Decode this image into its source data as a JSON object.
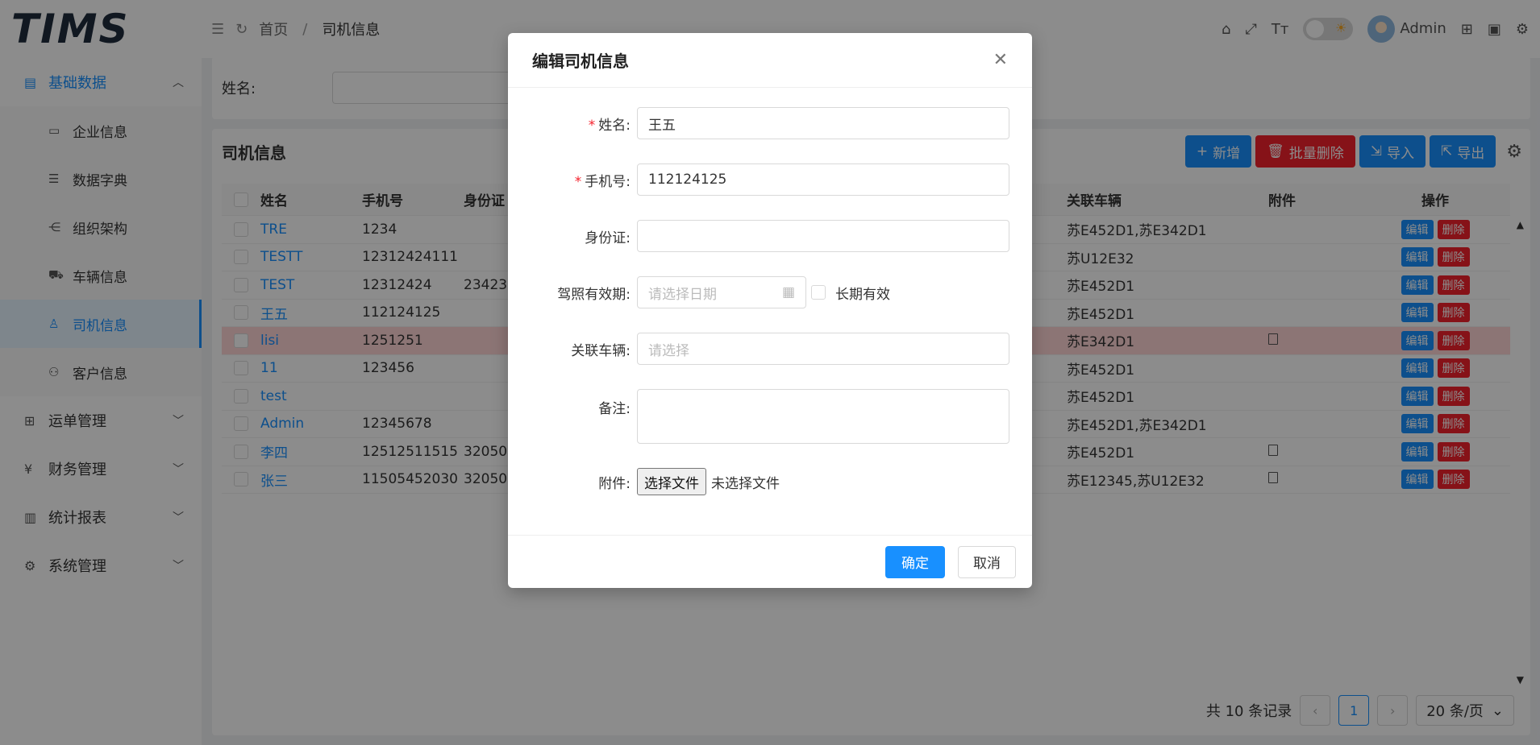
{
  "header": {
    "logo": "TIMS",
    "breadcrumb_home": "首页",
    "breadcrumb_sep": "/",
    "breadcrumb_current": "司机信息",
    "user_name": "Admin"
  },
  "sidebar": {
    "groups": [
      {
        "label": "基础数据",
        "icon": "list-icon"
      },
      {
        "label": "运单管理",
        "icon": "grid-icon"
      },
      {
        "label": "财务管理",
        "icon": "yen-icon"
      },
      {
        "label": "统计报表",
        "icon": "bar-chart-icon"
      },
      {
        "label": "系统管理",
        "icon": "gear-icon"
      }
    ],
    "sub_items": [
      {
        "label": "企业信息",
        "icon": "image-icon"
      },
      {
        "label": "数据字典",
        "icon": "list-icon"
      },
      {
        "label": "组织架构",
        "icon": "org-icon"
      },
      {
        "label": "车辆信息",
        "icon": "car-icon"
      },
      {
        "label": "司机信息",
        "icon": "user-icon"
      },
      {
        "label": "客户信息",
        "icon": "users-icon"
      }
    ]
  },
  "search": {
    "name_label": "姓名:"
  },
  "table": {
    "title": "司机信息",
    "buttons": {
      "add": "新增",
      "batch_delete": "批量删除",
      "import": "导入",
      "export": "导出"
    },
    "columns": {
      "name": "姓名",
      "phone": "手机号",
      "id": "身份证",
      "vehicle": "关联车辆",
      "attachment": "附件",
      "ops": "操作"
    },
    "op_edit": "编辑",
    "op_delete": "删除",
    "rows": [
      {
        "name": "TRE",
        "phone": "1234",
        "id": "",
        "vehicle": "苏E452D1,苏E342D1",
        "has_file": false
      },
      {
        "name": "TESTT",
        "phone": "12312424111",
        "id": "",
        "vehicle": "苏U12E32",
        "has_file": false
      },
      {
        "name": "TEST",
        "phone": "12312424",
        "id": "23423",
        "vehicle": "苏E452D1",
        "has_file": false
      },
      {
        "name": "王五",
        "phone": "112124125",
        "id": "",
        "vehicle": "苏E452D1",
        "has_file": false
      },
      {
        "name": "lisi",
        "phone": "1251251",
        "id": "",
        "vehicle": "苏E342D1",
        "has_file": true
      },
      {
        "name": "11",
        "phone": "123456",
        "id": "",
        "vehicle": "苏E452D1",
        "has_file": false
      },
      {
        "name": "test",
        "phone": "",
        "id": "",
        "vehicle": "苏E452D1",
        "has_file": false
      },
      {
        "name": "Admin",
        "phone": "12345678",
        "id": "",
        "vehicle": "苏E452D1,苏E342D1",
        "has_file": false
      },
      {
        "name": "李四",
        "phone": "12512511515",
        "id": "32050",
        "vehicle": "苏E452D1",
        "has_file": true
      },
      {
        "name": "张三",
        "phone": "11505452030",
        "id": "32050",
        "vehicle": "苏E12345,苏U12E32",
        "has_file": true
      }
    ]
  },
  "pager": {
    "total_text": "共 10 条记录",
    "current_page": "1",
    "page_size": "20 条/页"
  },
  "modal": {
    "title": "编辑司机信息",
    "fields": {
      "name_label": "姓名:",
      "name_value": "王五",
      "phone_label": "手机号:",
      "phone_value": "112124125",
      "id_label": "身份证:",
      "id_value": "",
      "license_label": "驾照有效期:",
      "license_placeholder": "请选择日期",
      "long_term_label": "长期有效",
      "vehicle_label": "关联车辆:",
      "vehicle_placeholder": "请选择",
      "remark_label": "备注:",
      "attachment_label": "附件:",
      "file_button": "选择文件",
      "file_status": "未选择文件"
    },
    "ok_label": "确定",
    "cancel_label": "取消"
  },
  "colors": {
    "primary": "#1890ff",
    "danger": "#f5222d",
    "highlight_row": "#ffd6d6"
  }
}
